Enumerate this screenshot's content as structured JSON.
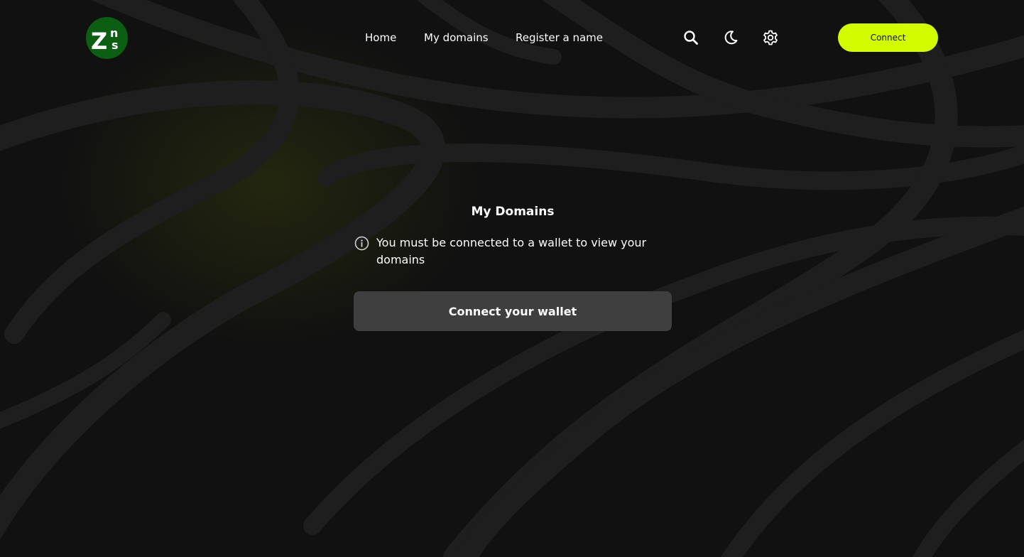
{
  "header": {
    "logo": {
      "text_main": "Z",
      "text_sup": "n",
      "text_sub": "s",
      "bg_color": "#0c5e12"
    },
    "nav": [
      {
        "label": "Home"
      },
      {
        "label": "My domains"
      },
      {
        "label": "Register a name"
      }
    ],
    "icons": [
      "search-icon",
      "moon-icon",
      "gear-icon"
    ],
    "connect_label": "Connect",
    "connect_color": "#d2fb00"
  },
  "main": {
    "title": "My Domains",
    "notice": "You must be connected to a wallet to view your domains",
    "notice_icon": "info-icon",
    "wallet_button_label": "Connect your wallet"
  },
  "colors": {
    "background": "#111111",
    "pattern_stroke": "#1e1e1e",
    "button_gray": "#3f3f3f"
  }
}
